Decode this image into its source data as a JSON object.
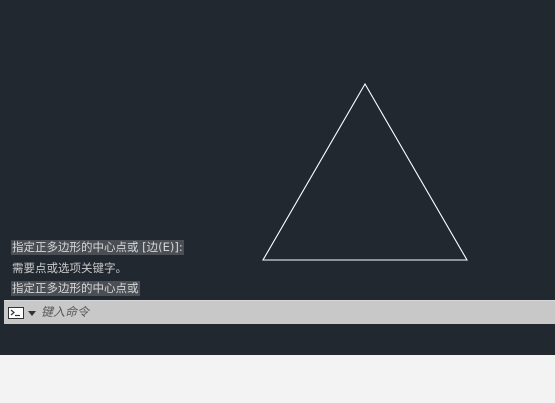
{
  "history": [
    {
      "text": "指定正多边形的中心点或 [边(E)]:",
      "highlight": true
    },
    {
      "text": "需要点或选项关键字。",
      "highlight": false
    },
    {
      "text": "指定正多边形的中心点或",
      "highlight": true
    }
  ],
  "command_line": {
    "placeholder": "键入命令",
    "value": ""
  },
  "icons": {
    "command_prompt": "terminal-icon",
    "dropdown": "caret-down-icon"
  },
  "colors": {
    "canvas": "#212830",
    "stroke": "#ffffff",
    "command_bar": "#c8c8c8"
  }
}
